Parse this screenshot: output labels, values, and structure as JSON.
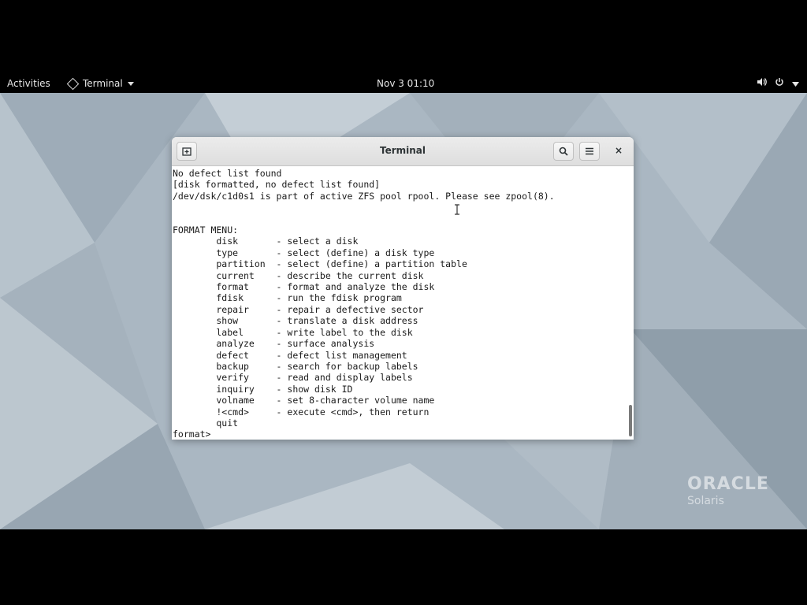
{
  "topbar": {
    "activities": "Activities",
    "app_name": "Terminal",
    "clock": "Nov 3  01:10",
    "icons": [
      "volume-icon",
      "power-icon",
      "chevron-down-icon"
    ]
  },
  "window": {
    "title": "Terminal",
    "new_tab_icon": "new-tab-icon",
    "search_icon": "search-icon",
    "menu_icon": "hamburger-menu-icon",
    "close_glyph": "×"
  },
  "terminal": {
    "lines": [
      "No defect list found",
      "[disk formatted, no defect list found]",
      "/dev/dsk/c1d0s1 is part of active ZFS pool rpool. Please see zpool(8).",
      "",
      "",
      "FORMAT MENU:",
      "        disk       - select a disk",
      "        type       - select (define) a disk type",
      "        partition  - select (define) a partition table",
      "        current    - describe the current disk",
      "        format     - format and analyze the disk",
      "        fdisk      - run the fdisk program",
      "        repair     - repair a defective sector",
      "        show       - translate a disk address",
      "        label      - write label to the disk",
      "        analyze    - surface analysis",
      "        defect     - defect list management",
      "        backup     - search for backup labels",
      "        verify     - read and display labels",
      "        inquiry    - show disk ID",
      "        volname    - set 8-character volume name",
      "        !<cmd>     - execute <cmd>, then return",
      "        quit",
      "format>"
    ]
  },
  "branding": {
    "line1": "ORACLE",
    "line2": "Solaris"
  }
}
